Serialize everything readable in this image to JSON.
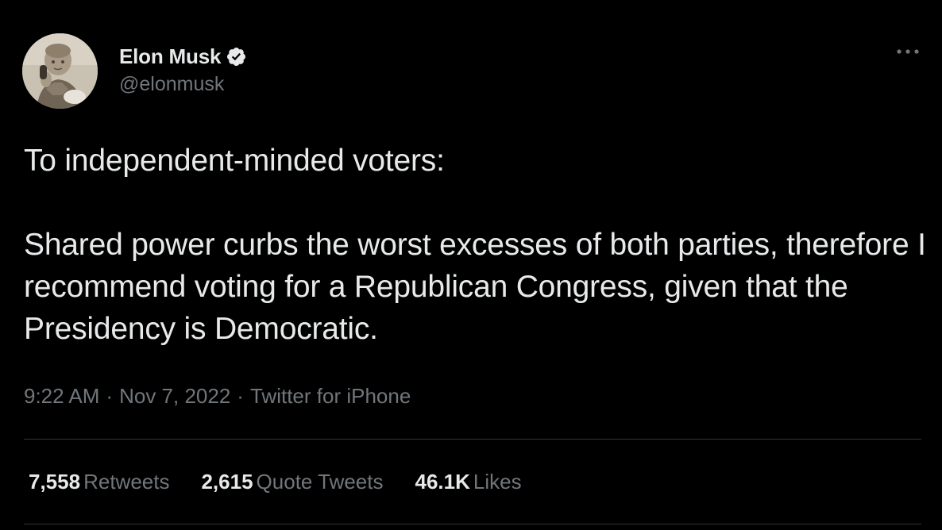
{
  "author": {
    "name": "Elon Musk",
    "handle": "@elonmusk",
    "verified": true,
    "verified_color": "#e7e9ea"
  },
  "tweet": {
    "lines": [
      "To independent-minded voters:",
      "Shared power curbs the worst excesses of both parties, therefore I recommend voting for a Republican Congress, given that the Presidency is Democratic."
    ]
  },
  "meta": {
    "time": "9:22 AM",
    "date": "Nov 7, 2022",
    "source": "Twitter for iPhone",
    "separator": "·"
  },
  "stats": {
    "retweets_count": "7,558",
    "retweets_label": "Retweets",
    "quotes_count": "2,615",
    "quotes_label": "Quote Tweets",
    "likes_count": "46.1K",
    "likes_label": "Likes"
  },
  "icons": {
    "verified": "verified-badge-icon",
    "more": "more-dots-icon"
  },
  "colors": {
    "background": "#000000",
    "text_primary": "#e7e9ea",
    "text_secondary": "#71767b",
    "divider": "#2f3336"
  }
}
